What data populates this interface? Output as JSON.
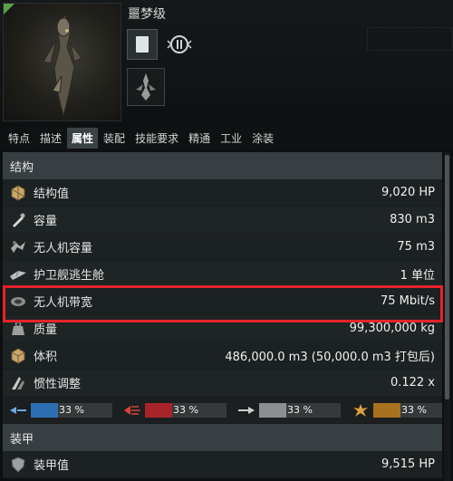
{
  "ship": {
    "name": "噩梦级"
  },
  "tabs": [
    {
      "label": "特点"
    },
    {
      "label": "描述"
    },
    {
      "label": "属性"
    },
    {
      "label": "装配"
    },
    {
      "label": "技能要求"
    },
    {
      "label": "精通"
    },
    {
      "label": "工业"
    },
    {
      "label": "涂装"
    }
  ],
  "active_tab": "属性",
  "sections": {
    "structure": "结构",
    "armor": "装甲"
  },
  "structure_rows": [
    {
      "label": "结构值",
      "value": "9,020 HP",
      "icon": "structure-hp-icon"
    },
    {
      "label": "容量",
      "value": "830 m3",
      "icon": "cargo-capacity-icon"
    },
    {
      "label": "无人机容量",
      "value": "75 m3",
      "icon": "drone-capacity-icon"
    },
    {
      "label": "护卫舰逃生舱",
      "value": "1 单位",
      "icon": "escape-bay-icon"
    },
    {
      "label": "无人机带宽",
      "value": "75 Mbit/s",
      "icon": "drone-bandwidth-icon"
    },
    {
      "label": "质量",
      "value": "99,300,000 kg",
      "icon": "mass-icon"
    },
    {
      "label": "体积",
      "value": "486,000.0 m3 (50,000.0 m3 打包后)",
      "icon": "volume-icon"
    },
    {
      "label": "惯性调整",
      "value": "0.122 x",
      "icon": "inertia-icon"
    }
  ],
  "resistances": [
    {
      "type": "em",
      "pct_label": "33 %",
      "fraction": 0.33,
      "color": "#2d6fb3",
      "icon": "em-resist-icon"
    },
    {
      "type": "thermal",
      "pct_label": "33 %",
      "fraction": 0.33,
      "color": "#a8242a",
      "icon": "thermal-resist-icon"
    },
    {
      "type": "kinetic",
      "pct_label": "33 %",
      "fraction": 0.33,
      "color": "#8c8f90",
      "icon": "kinetic-resist-icon"
    },
    {
      "type": "explosive",
      "pct_label": "33 %",
      "fraction": 0.33,
      "color": "#a8711f",
      "icon": "explosive-resist-icon"
    }
  ],
  "armor_rows": [
    {
      "label": "装甲值",
      "value": "9,515 HP",
      "icon": "armor-hp-icon"
    }
  ],
  "colors": {
    "highlight": "#e8232a",
    "section_bg": "#383f42",
    "row_bg": "#1c2122"
  }
}
